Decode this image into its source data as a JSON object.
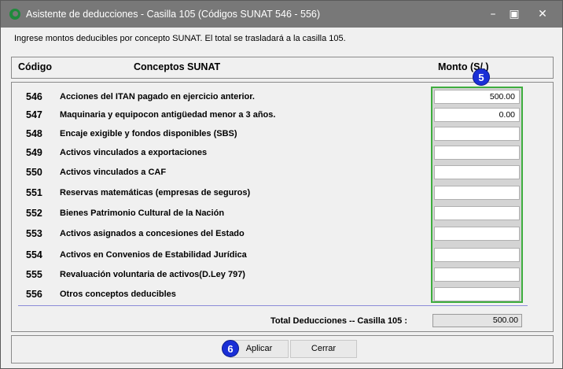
{
  "window": {
    "title": "Asistente de deducciones - Casilla 105 (Códigos SUNAT 546 - 556)",
    "minimize_icon": "minimize-icon",
    "maximize_icon": "maximize-icon",
    "close_icon": "close-icon"
  },
  "instructions": "Ingrese montos deducibles por concepto SUNAT. El total se trasladará a la casilla 105.",
  "header": {
    "codigo": "Código",
    "conceptos": "Conceptos SUNAT",
    "monto": "Monto (S/.)"
  },
  "rows": [
    {
      "code": "546",
      "label": "Acciones del ITAN pagado en ejercicio anterior.",
      "amount": "500.00"
    },
    {
      "code": "547",
      "label": "Maquinaria y equipocon antigüedad menor a 3 años.",
      "amount": "0.00"
    },
    {
      "code": "548",
      "label": "Encaje exigible y fondos disponibles (SBS)",
      "amount": ""
    },
    {
      "code": "549",
      "label": "Activos vinculados a exportaciones",
      "amount": ""
    },
    {
      "code": "550",
      "label": "Activos vinculados a CAF",
      "amount": ""
    },
    {
      "code": "551",
      "label": "Reservas matemáticas (empresas de seguros)",
      "amount": ""
    },
    {
      "code": "552",
      "label": "Bienes Patrimonio Cultural de la  Nación",
      "amount": ""
    },
    {
      "code": "553",
      "label": "Activos asignados a concesiones del Estado",
      "amount": ""
    },
    {
      "code": "554",
      "label": "Activos en Convenios de Estabilidad Jurídica",
      "amount": ""
    },
    {
      "code": "555",
      "label": "Revaluación voluntaria de activos(D.Ley 797)",
      "amount": ""
    },
    {
      "code": "556",
      "label": "Otros conceptos deducibles",
      "amount": ""
    }
  ],
  "total": {
    "label": "Total Deducciones -- Casilla 105 :",
    "value": "500.00"
  },
  "buttons": {
    "aplicar": "Aplicar",
    "cerrar": "Cerrar"
  },
  "badges": {
    "five": "5",
    "six": "6"
  },
  "colors": {
    "titlebar": "#787878",
    "highlight_green": "#3fae3f",
    "badge_blue": "#1a2fd6"
  }
}
